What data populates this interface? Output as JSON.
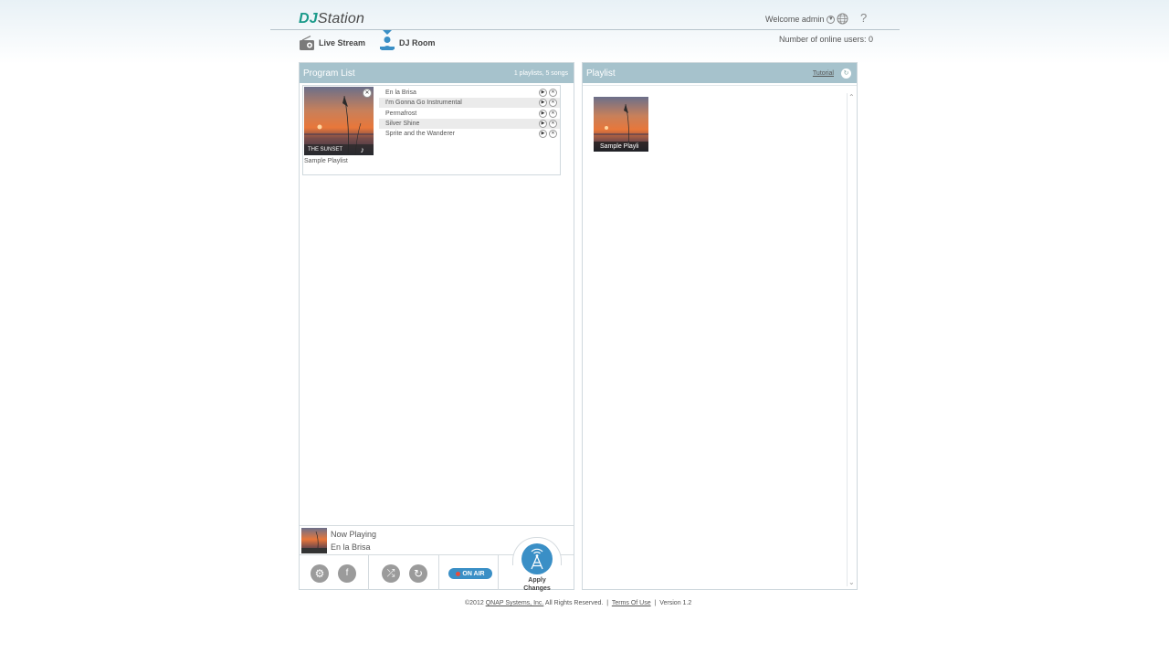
{
  "app": {
    "logo_dj": "DJ",
    "logo_station": "Station"
  },
  "header": {
    "welcome": "Welcome admin",
    "help_label": "?",
    "online_users": "Number of online users: 0"
  },
  "nav": {
    "live_stream": "Live Stream",
    "dj_room": "DJ Room"
  },
  "program_list": {
    "title": "Program List",
    "summary": "1 playlists, 5 songs",
    "playlist": {
      "name": "Sample Playlist",
      "cover_caption": "THE SUNSET",
      "songs": [
        "En la Brisa",
        "I'm Gonna Go Instrumental",
        "Permafrost",
        "Silver Shine",
        "Sprite and the Wanderer"
      ]
    },
    "now_playing": {
      "label": "Now Playing",
      "song": "En la Brisa"
    },
    "controls": {
      "on_air": "ON AIR",
      "apply": "Apply Changes"
    }
  },
  "playlist": {
    "title": "Playlist",
    "tutorial": "Tutorial",
    "thumb_caption": "Sample Playli"
  },
  "footer": {
    "copyright": "©2012",
    "company": "QNAP Systems, Inc.",
    "rights": "All Rights Reserved.",
    "terms": "Terms Of Use",
    "version": "Version 1.2"
  },
  "colors": {
    "accent": "#3a8fc6",
    "panel_header": "#a6c2cc",
    "logo_green": "#1a9a8a"
  }
}
